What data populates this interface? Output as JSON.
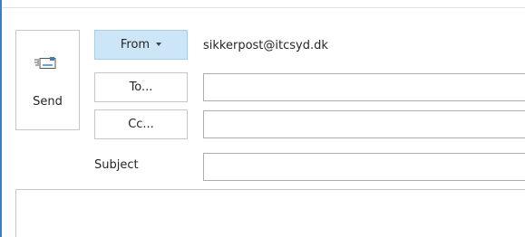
{
  "send": {
    "label": "Send",
    "icon": "send-envelope-icon"
  },
  "from": {
    "label": "From",
    "icon": "chevron-down-icon",
    "address": "sikkerpost@itcsyd.dk"
  },
  "to": {
    "label": "To...",
    "value": ""
  },
  "cc": {
    "label": "Cc...",
    "value": ""
  },
  "subject": {
    "label": "Subject",
    "value": ""
  },
  "body": {
    "value": ""
  },
  "colors": {
    "accent": "#3a7fc4",
    "from_button_bg": "#cde6f7"
  }
}
